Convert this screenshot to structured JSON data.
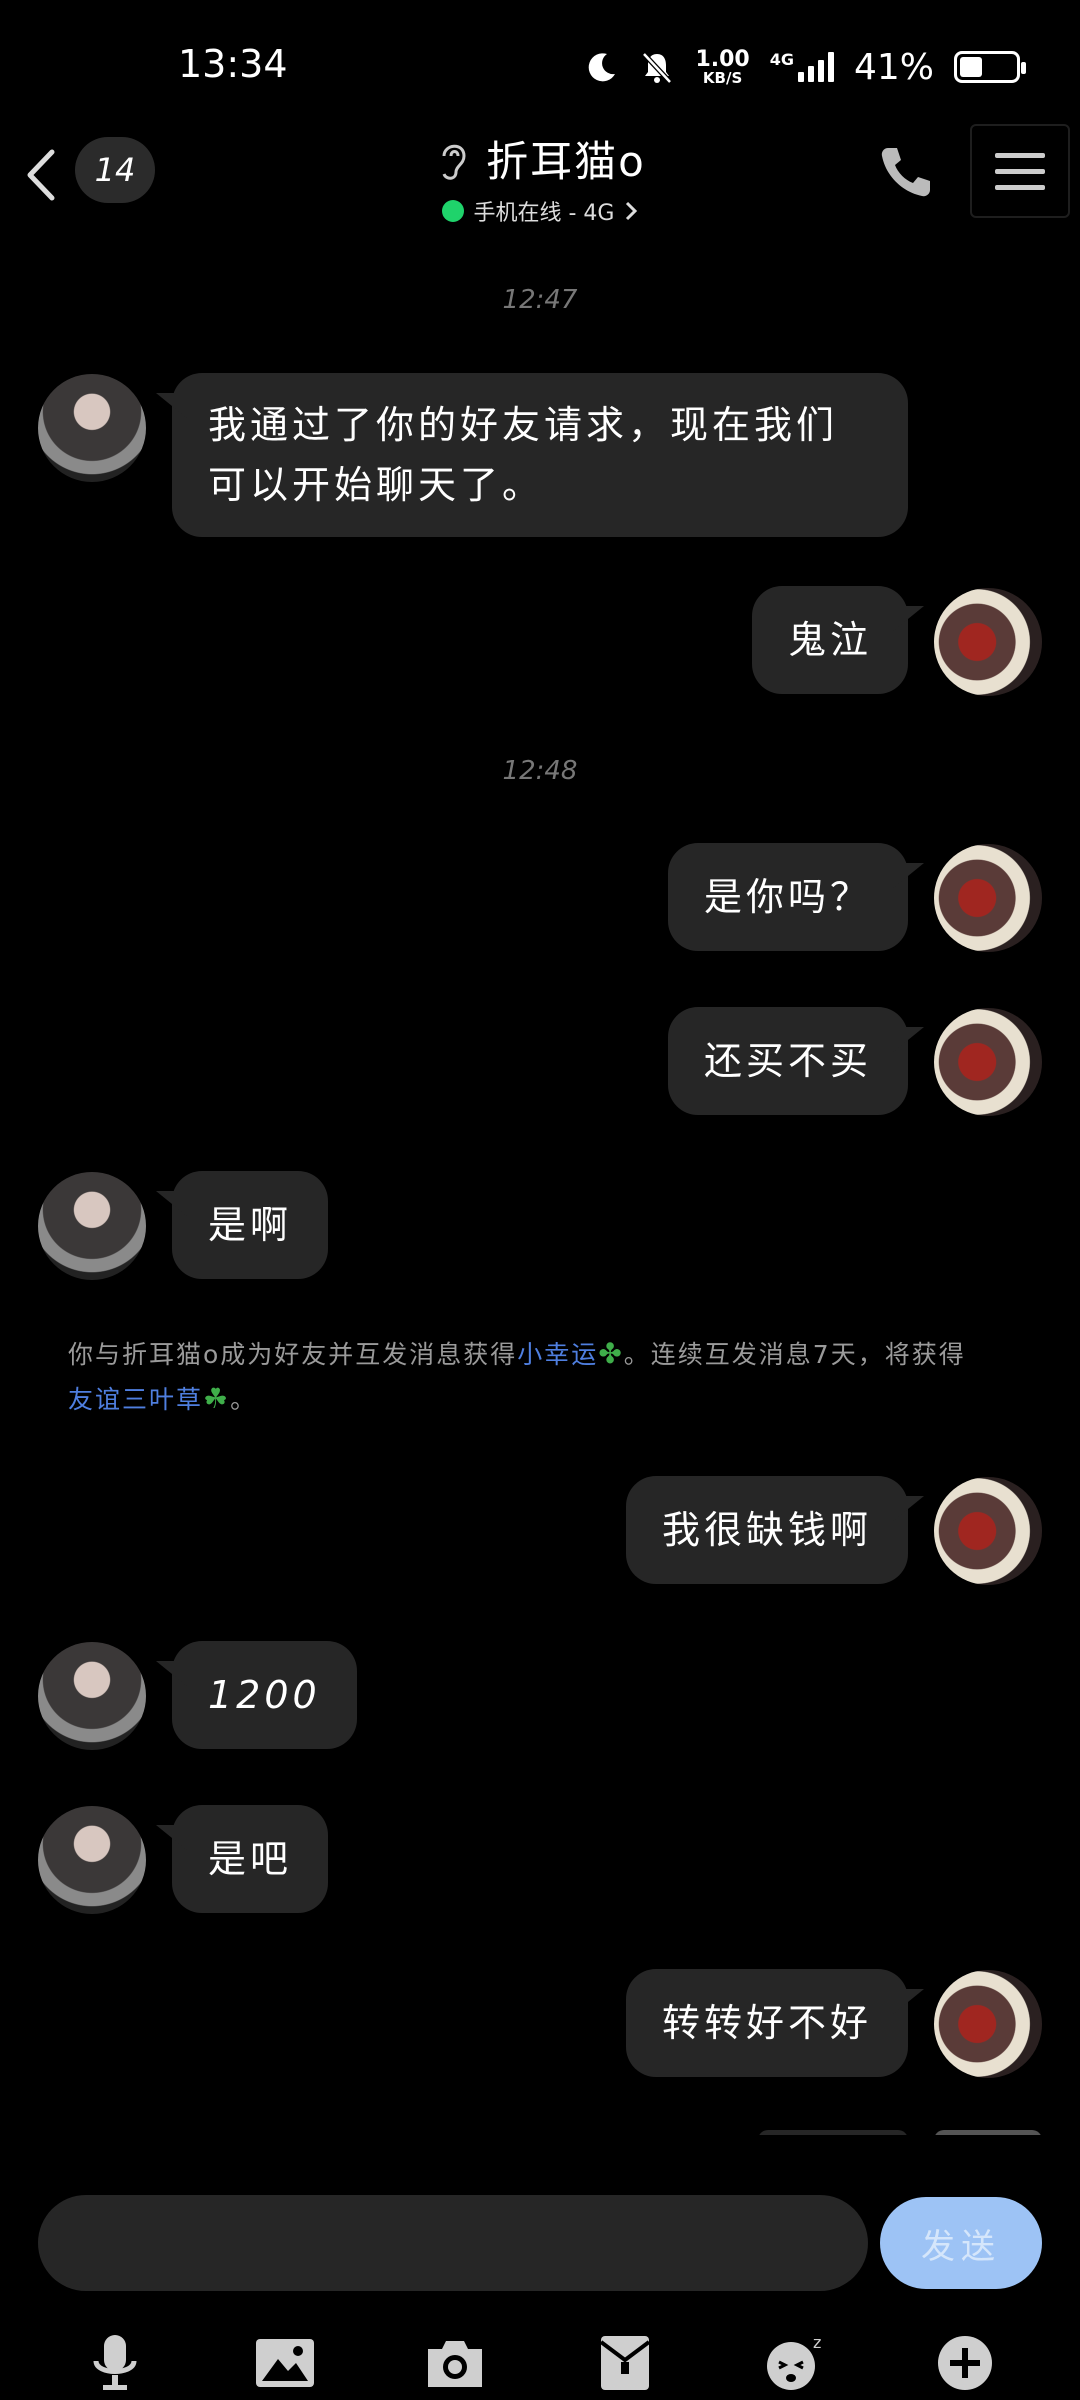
{
  "status_bar": {
    "time": "13:34",
    "net_speed": "1.00",
    "net_unit": "KB/S",
    "network": "4G",
    "battery_percent": "41%",
    "battery_level": 0.41
  },
  "header": {
    "unread_count": "14",
    "contact_name": "折耳猫o",
    "status_text": "手机在线 - 4G",
    "icons": [
      "back-icon",
      "ear-icon",
      "phone-icon",
      "menu-icon"
    ]
  },
  "messages": [
    {
      "type": "time",
      "text": "12:47"
    },
    {
      "type": "left",
      "text": "我通过了你的好友请求，现在我们可以开始聊天了。"
    },
    {
      "type": "right",
      "text": "鬼泣"
    },
    {
      "type": "time",
      "text": "12:48"
    },
    {
      "type": "right",
      "text": "是你吗？"
    },
    {
      "type": "right",
      "text": "还买不买"
    },
    {
      "type": "left",
      "text": "是啊"
    },
    {
      "type": "system",
      "part1": "你与折耳猫o成为好友并互发消息获得",
      "link1": "小幸运",
      "part2": "。连续互发消息7天，将获得",
      "link2": "友谊三叶草",
      "part3": "。"
    },
    {
      "type": "right",
      "text": "我很缺钱啊"
    },
    {
      "type": "left",
      "text": "1200"
    },
    {
      "type": "left",
      "text": "是吧"
    },
    {
      "type": "right",
      "text": "转转好不好"
    }
  ],
  "input": {
    "value": "",
    "send_label": "发送"
  },
  "toolbar": [
    "microphone-icon",
    "image-icon",
    "camera-icon",
    "red-packet-icon",
    "emoji-icon",
    "plus-icon"
  ]
}
